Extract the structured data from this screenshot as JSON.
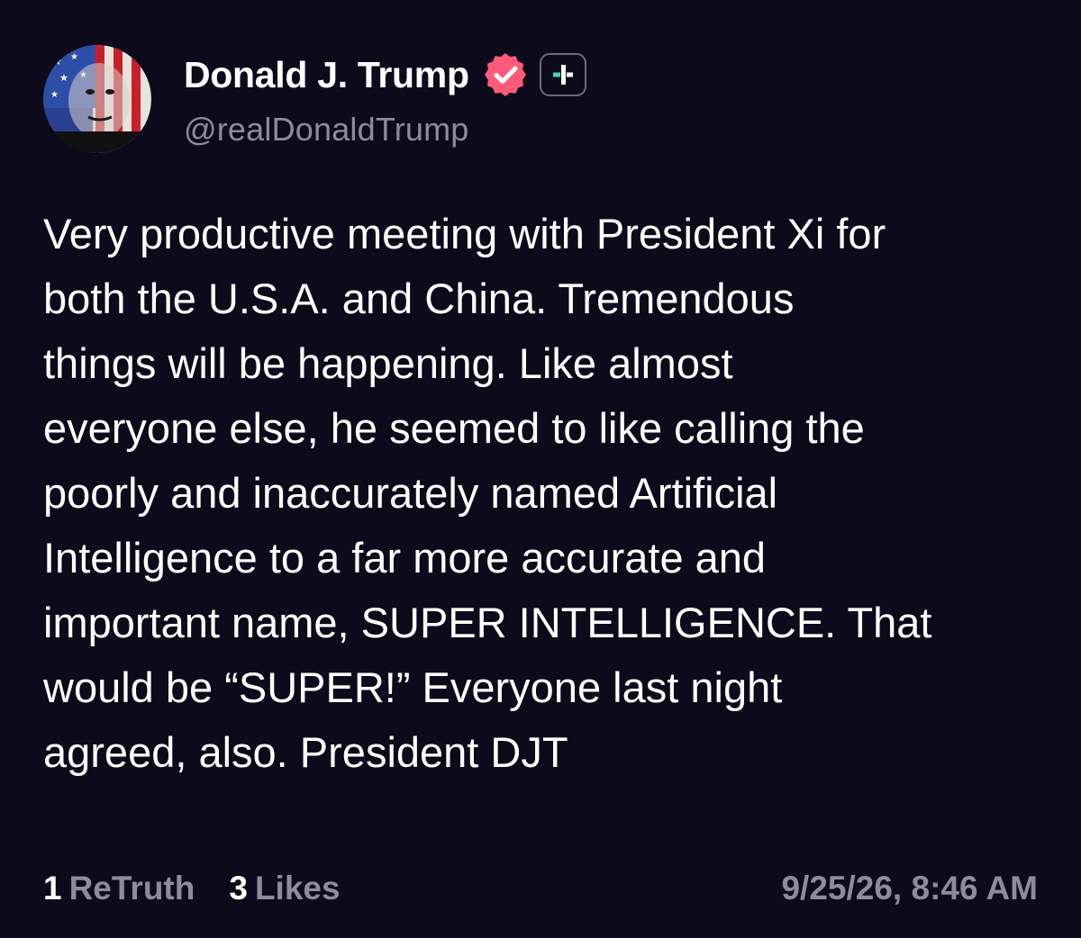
{
  "author": {
    "display_name": "Donald J. Trump",
    "handle": "@realDonaldTrump",
    "avatar_icon": "flag-portrait-avatar",
    "verified_icon": "verified-badge-icon",
    "subscription_icon": "plus-badge-icon"
  },
  "post": {
    "lines": [
      "Very productive meeting with President Xi for",
      "both the U.S.A. and China. Tremendous",
      "things will be happening. Like almost",
      "everyone else, he seemed to like calling the",
      "poorly and inaccurately named Artificial",
      "Intelligence to a far more accurate and",
      "important name, SUPER INTELLIGENCE. That",
      "would be “SUPER!” Everyone last night",
      "agreed, also. President DJT"
    ]
  },
  "stats": {
    "retruths_count": "1",
    "retruths_label": "ReTruth",
    "likes_count": "3",
    "likes_label": "Likes"
  },
  "timestamp": "9/25/26, 8:46 AM",
  "colors": {
    "background": "#0c0a1b",
    "verified": "#ff5a7a",
    "plus_accent": "#3dd6b5",
    "muted": "#8e8b9c"
  }
}
